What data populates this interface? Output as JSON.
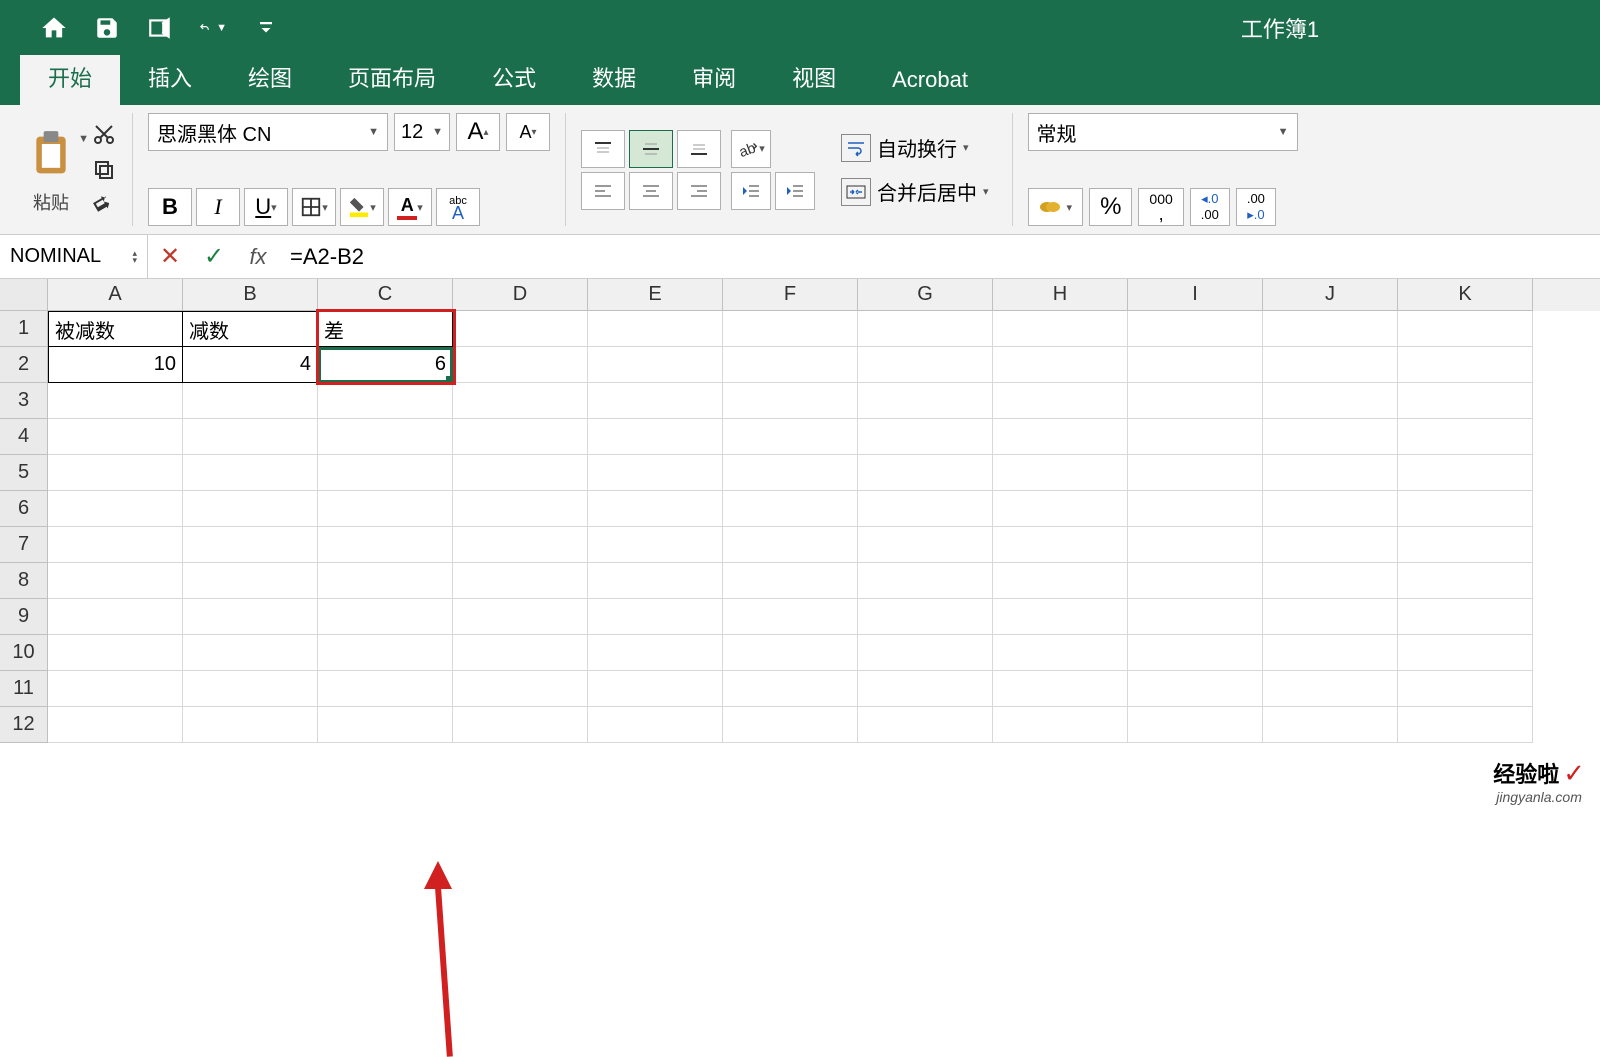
{
  "doc_title": "工作簿1",
  "tabs": [
    "开始",
    "插入",
    "绘图",
    "页面布局",
    "公式",
    "数据",
    "审阅",
    "视图",
    "Acrobat"
  ],
  "active_tab": 0,
  "clipboard": {
    "paste_label": "粘贴"
  },
  "font": {
    "name": "思源黑体 CN",
    "size": "12",
    "increase": "A",
    "decrease": "A",
    "bold": "B",
    "italic": "I",
    "underline": "U",
    "ruby": "abc"
  },
  "wrap": {
    "auto": "自动换行",
    "merge": "合并后居中"
  },
  "number": {
    "format": "常规",
    "percent": "%",
    "comma": "000",
    "inc": ".0",
    "dec": ".00"
  },
  "formula_bar": {
    "name_box": "NOMINAL",
    "formula": "=A2-B2"
  },
  "columns": [
    "A",
    "B",
    "C",
    "D",
    "E",
    "F",
    "G",
    "H",
    "I",
    "J",
    "K"
  ],
  "rows": [
    "1",
    "2",
    "3",
    "4",
    "5",
    "6",
    "7",
    "8",
    "9",
    "10",
    "11",
    "12"
  ],
  "cells": {
    "A1": "被减数",
    "B1": "减数",
    "C1": "差",
    "A2": "10",
    "B2": "4",
    "C2": "6"
  },
  "watermark": {
    "top": "经验啦",
    "bot": "jingyanla.com"
  }
}
